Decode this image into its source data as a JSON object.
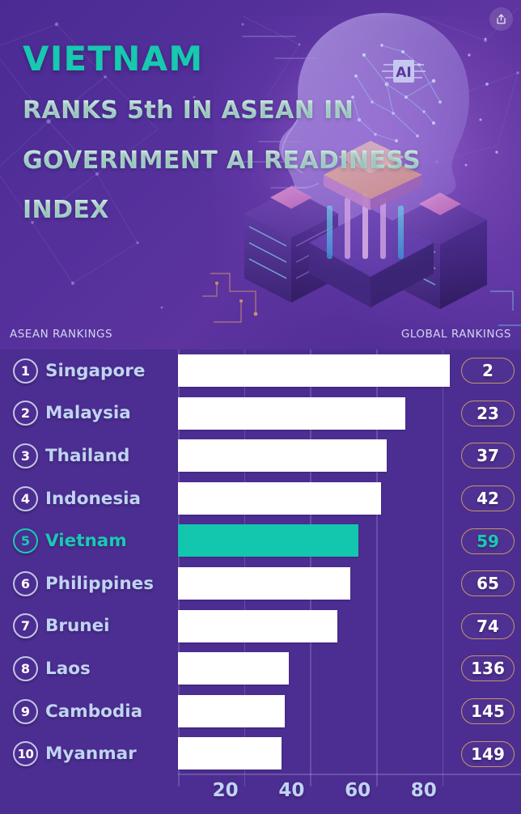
{
  "hero": {
    "title": "VIETNAM",
    "line1": "RANKS 5th IN ASEAN IN",
    "line2": "GOVERNMENT AI READINESS",
    "line3": "INDEX",
    "share_icon": "share-icon",
    "accent_color": "#16c9b0",
    "text_color": "#c9f3ea",
    "background_color": "#4c2d91"
  },
  "sections": {
    "left_label": "ASEAN RANKINGS",
    "right_label": "GLOBAL RANKINGS"
  },
  "chart_data": {
    "type": "bar",
    "orientation": "horizontal",
    "title": "VIETNAM RANKS 5th IN ASEAN IN GOVERNMENT AI READINESS INDEX",
    "xlabel": "",
    "ylabel": "",
    "xlim": [
      0,
      100
    ],
    "xticks": [
      20,
      40,
      60,
      80
    ],
    "grid": true,
    "legend": null,
    "highlight": "Vietnam",
    "highlight_color": "#13c6ae",
    "bar_color": "#ffffff",
    "categories": [
      "Singapore",
      "Malaysia",
      "Thailand",
      "Indonesia",
      "Vietnam",
      "Philippines",
      "Brunei",
      "Laos",
      "Cambodia",
      "Myanmar"
    ],
    "values": [
      82.2,
      68.8,
      63.2,
      61.5,
      54.6,
      52.1,
      48.2,
      33.5,
      32.3,
      31.3
    ],
    "asean_ranks": [
      1,
      2,
      3,
      4,
      5,
      6,
      7,
      8,
      9,
      10
    ],
    "global_ranks": [
      2,
      23,
      37,
      42,
      59,
      65,
      74,
      136,
      145,
      149
    ],
    "rows": [
      {
        "rank": "1",
        "country": "Singapore",
        "value": 82.2,
        "global": "2",
        "highlight": false
      },
      {
        "rank": "2",
        "country": "Malaysia",
        "value": 68.8,
        "global": "23",
        "highlight": false
      },
      {
        "rank": "3",
        "country": "Thailand",
        "value": 63.2,
        "global": "37",
        "highlight": false
      },
      {
        "rank": "4",
        "country": "Indonesia",
        "value": 61.5,
        "global": "42",
        "highlight": false
      },
      {
        "rank": "5",
        "country": "Vietnam",
        "value": 54.6,
        "global": "59",
        "highlight": true
      },
      {
        "rank": "6",
        "country": "Philippines",
        "value": 52.1,
        "global": "65",
        "highlight": false
      },
      {
        "rank": "7",
        "country": "Brunei",
        "value": 48.2,
        "global": "74",
        "highlight": false
      },
      {
        "rank": "8",
        "country": "Laos",
        "value": 33.5,
        "global": "136",
        "highlight": false
      },
      {
        "rank": "9",
        "country": "Cambodia",
        "value": 32.3,
        "global": "145",
        "highlight": false
      },
      {
        "rank": "10",
        "country": "Myanmar",
        "value": 31.3,
        "global": "149",
        "highlight": false
      }
    ]
  }
}
